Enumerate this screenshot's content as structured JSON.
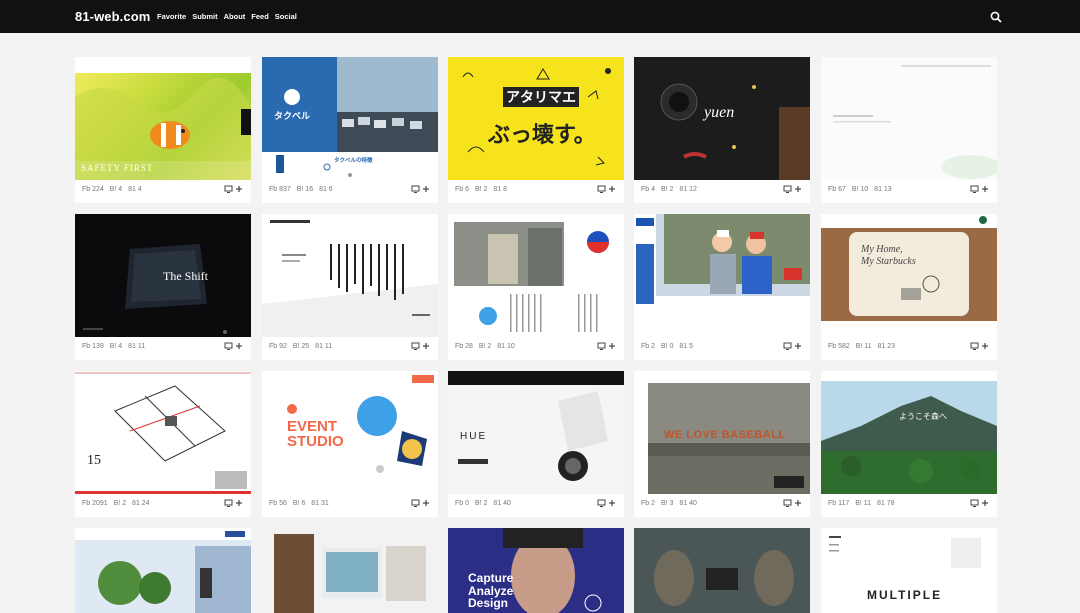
{
  "header": {
    "logo": "81-web.com",
    "nav": [
      "Favorite",
      "Submit",
      "About",
      "Feed",
      "Social"
    ]
  },
  "cards": [
    {
      "texts": [
        "SAFETY FIRST"
      ],
      "fb": "Fb 224",
      "b1": "B! 4",
      "b2": "81 4"
    },
    {
      "texts": [
        "タクベル",
        "タクベルの特徴"
      ],
      "fb": "Fb 837",
      "b1": "B! 16",
      "b2": "81 6"
    },
    {
      "texts": [
        "アタリマエ",
        "ぶっ壊す。"
      ],
      "fb": "Fb 6",
      "b1": "B! 2",
      "b2": "81 8"
    },
    {
      "texts": [
        "yuen"
      ],
      "fb": "Fb 4",
      "b1": "B! 2",
      "b2": "81 12"
    },
    {
      "texts": [],
      "fb": "Fb 67",
      "b1": "B! 10",
      "b2": "81 13"
    },
    {
      "texts": [
        "The Shift"
      ],
      "fb": "Fb 139",
      "b1": "B! 4",
      "b2": "81 11"
    },
    {
      "texts": [],
      "fb": "Fb 92",
      "b1": "B! 25",
      "b2": "81 11"
    },
    {
      "texts": [],
      "fb": "Fb 28",
      "b1": "B! 2",
      "b2": "81 10"
    },
    {
      "texts": [],
      "fb": "Fb 2",
      "b1": "B! 0",
      "b2": "81 5"
    },
    {
      "texts": [
        "My Home,",
        "My Starbucks"
      ],
      "fb": "Fb 582",
      "b1": "B! 11",
      "b2": "81 23"
    },
    {
      "texts": [
        "15"
      ],
      "fb": "Fb 2091",
      "b1": "B! 2",
      "b2": "81 24"
    },
    {
      "texts": [
        "EVENT",
        "STUDIO"
      ],
      "fb": "Fb 56",
      "b1": "B! 6",
      "b2": "81 31"
    },
    {
      "texts": [
        "HUE"
      ],
      "fb": "Fb 0",
      "b1": "B! 2",
      "b2": "81 40"
    },
    {
      "texts": [
        "WE LOVE BASEBALL"
      ],
      "fb": "Fb 2",
      "b1": "B! 3",
      "b2": "81 40"
    },
    {
      "texts": [
        "ようこそ森へ"
      ],
      "fb": "Fb 117",
      "b1": "B! 11",
      "b2": "81 78"
    },
    {
      "texts": [],
      "fb": "",
      "b1": "",
      "b2": ""
    },
    {
      "texts": [],
      "fb": "",
      "b1": "",
      "b2": ""
    },
    {
      "texts": [
        "Capture",
        "Analyze",
        "Design"
      ],
      "fb": "",
      "b1": "",
      "b2": ""
    },
    {
      "texts": [],
      "fb": "",
      "b1": "",
      "b2": ""
    },
    {
      "texts": [
        "MULTIPLE"
      ],
      "fb": "",
      "b1": "",
      "b2": ""
    }
  ],
  "colors": {
    "header_bg": "#111111",
    "page_bg": "#f3f3f3"
  },
  "icons": {
    "search": "search-icon",
    "display": "display-icon",
    "add": "plus-icon"
  }
}
